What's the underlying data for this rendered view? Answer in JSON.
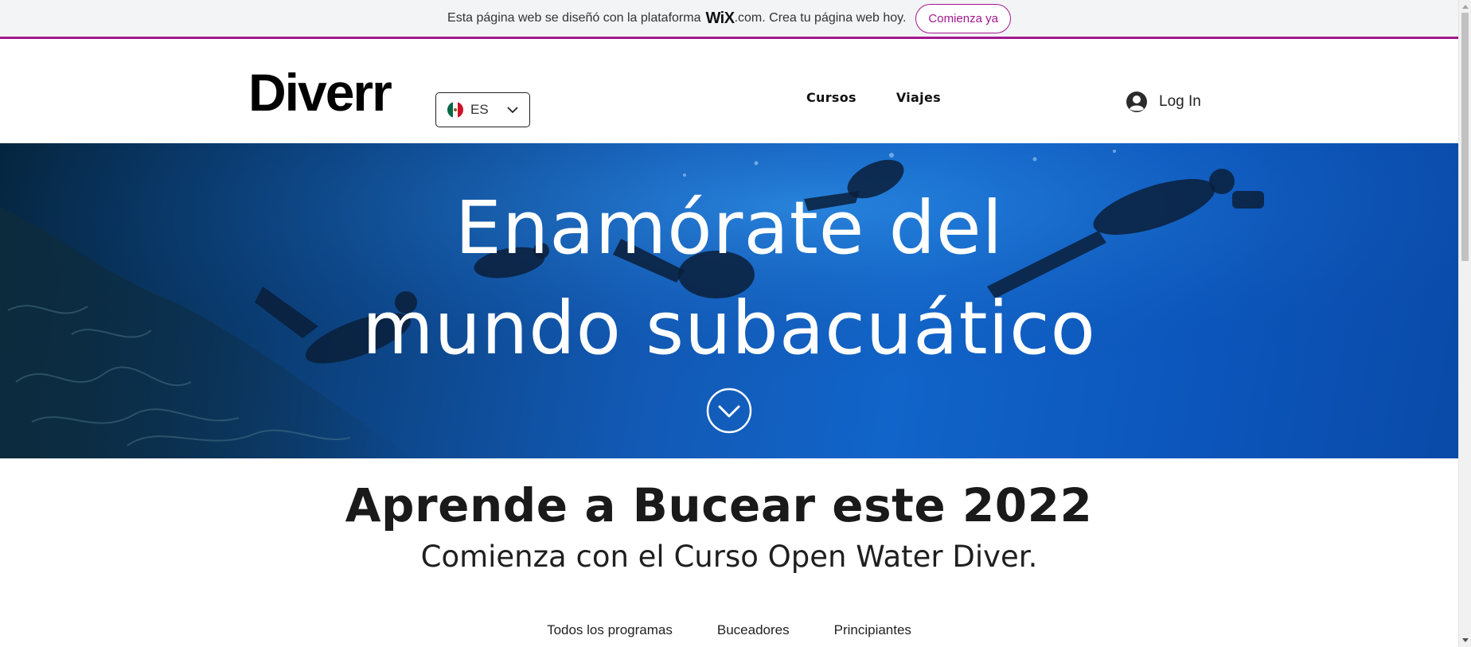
{
  "wix_banner": {
    "text_before": "Esta página web se diseñó con la plataforma",
    "logo": "WiX",
    "text_after": ".com. Crea tu página web hoy.",
    "button_label": "Comienza ya",
    "accent_color": "#a3178f"
  },
  "header": {
    "logo": "Diverr",
    "language": {
      "selected": "ES",
      "flag_icon": "mexico-flag-icon"
    },
    "nav": [
      {
        "label": "Cursos"
      },
      {
        "label": "Viajes"
      }
    ],
    "login_label": "Log In"
  },
  "hero": {
    "title_line1": "Enamórate del",
    "title_line2": "mundo subacuático",
    "scroll_icon": "chevron-down-circle-icon"
  },
  "intro": {
    "title": "Aprende a Bucear este 2022",
    "subtitle": "Comienza con el Curso Open Water Diver."
  },
  "program_tabs": [
    {
      "label": "Todos los programas"
    },
    {
      "label": "Buceadores"
    },
    {
      "label": "Principiantes"
    }
  ]
}
